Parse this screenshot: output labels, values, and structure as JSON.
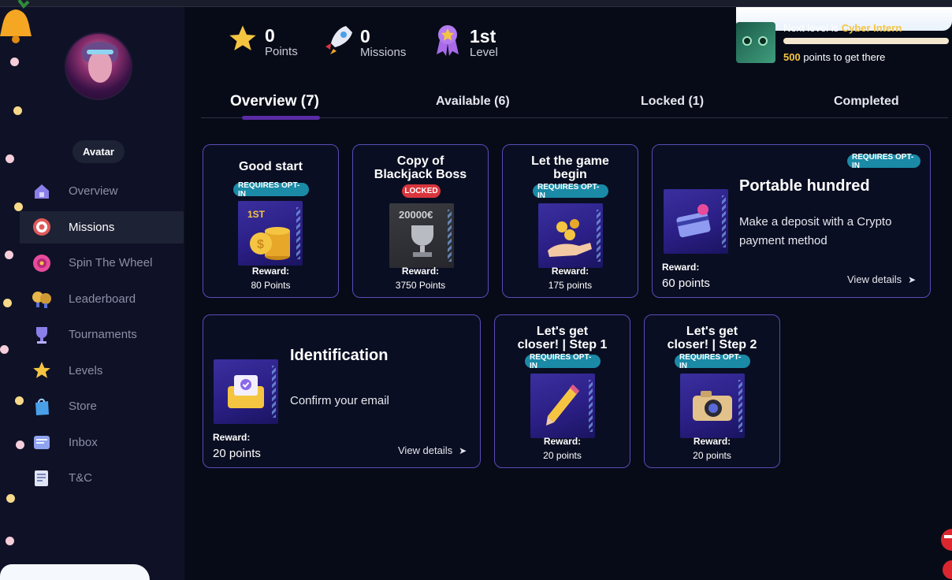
{
  "sidebar": {
    "avatar_label": "Avatar",
    "items": [
      {
        "label": "Overview",
        "icon": "house-icon"
      },
      {
        "label": "Missions",
        "icon": "target-icon"
      },
      {
        "label": "Spin The Wheel",
        "icon": "wheel-icon"
      },
      {
        "label": "Leaderboard",
        "icon": "medals-icon"
      },
      {
        "label": "Tournaments",
        "icon": "trophy-icon"
      },
      {
        "label": "Levels",
        "icon": "star-icon"
      },
      {
        "label": "Store",
        "icon": "shopping-bag-icon"
      },
      {
        "label": "Inbox",
        "icon": "inbox-icon"
      },
      {
        "label": "T&C",
        "icon": "document-icon"
      }
    ],
    "active": "Missions"
  },
  "header": {
    "stats": [
      {
        "value": "0",
        "label": "Points",
        "icon": "star-icon"
      },
      {
        "value": "0",
        "label": "Missions",
        "icon": "rocket-icon"
      },
      {
        "value": "1st",
        "label": "Level",
        "icon": "badge-icon"
      }
    ],
    "next_level_prefix": "Next level is",
    "next_level_name": "Cyber Intern",
    "progress": 0,
    "points_needed": "500",
    "points_suffix": "points to get there"
  },
  "tabs": [
    {
      "label": "Overview (7)"
    },
    {
      "label": "Available (6)"
    },
    {
      "label": "Locked (1)"
    },
    {
      "label": "Completed"
    }
  ],
  "missions": [
    {
      "title": "Good start",
      "badge": "REQUIRES OPT-IN",
      "art_text": "1ST",
      "reward_label": "Reward:",
      "reward": "80 Points"
    },
    {
      "title_line1": "Copy of",
      "title_line2": "Blackjack Boss",
      "badge": "LOCKED",
      "art_text": "20000€",
      "reward_label": "Reward:",
      "reward": "3750 Points"
    },
    {
      "title_line1": "Let the game",
      "title_line2": "begin",
      "badge": "REQUIRES OPT-IN",
      "reward_label": "Reward:",
      "reward": "175 points"
    },
    {
      "title": "Portable hundred",
      "badge": "REQUIRES OPT-IN",
      "description_line1": "Make a deposit with a Crypto",
      "description_line2": "payment method",
      "reward_label": "Reward:",
      "reward": "60 points",
      "cta": "View details"
    },
    {
      "title": "Identification",
      "description": "Confirm your email",
      "reward_label": "Reward:",
      "reward": "20 points",
      "cta": "View details"
    },
    {
      "title_line1": "Let's get",
      "title_line2": "closer! | Step 1",
      "badge": "REQUIRES OPT-IN",
      "reward_label": "Reward:",
      "reward": "20 points"
    },
    {
      "title_line1": "Let's get",
      "title_line2": "closer! | Step 2",
      "badge": "REQUIRES OPT-IN",
      "reward_label": "Reward:",
      "reward": "20 points"
    }
  ],
  "colors": {
    "accent": "#5b2ba6",
    "optin": "#1a8aa6",
    "locked": "#d9353d",
    "gold": "#f5c542",
    "border": "#5a4bb8"
  }
}
